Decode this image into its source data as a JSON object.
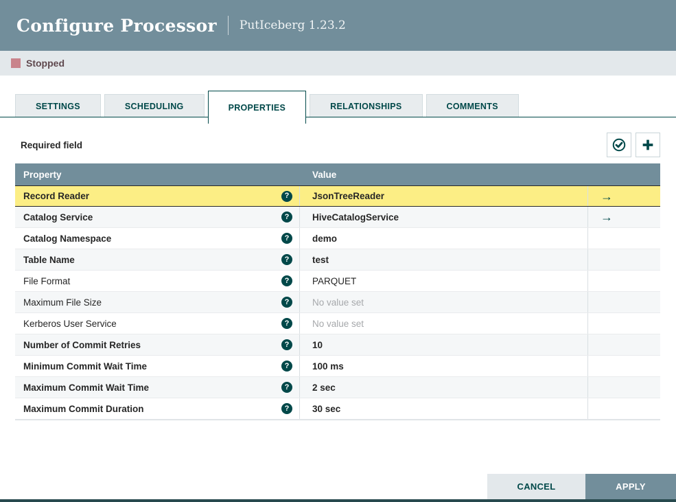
{
  "dialog": {
    "title": "Configure Processor",
    "subtitle": "PutIceberg 1.23.2",
    "status_label": "Stopped"
  },
  "tabs": [
    {
      "label": "SETTINGS",
      "active": false
    },
    {
      "label": "SCHEDULING",
      "active": false
    },
    {
      "label": "PROPERTIES",
      "active": true
    },
    {
      "label": "RELATIONSHIPS",
      "active": false
    },
    {
      "label": "COMMENTS",
      "active": false
    }
  ],
  "properties_panel": {
    "required_field_label": "Required field",
    "actions": [
      {
        "name": "verify-properties",
        "icon": "check-circle-icon"
      },
      {
        "name": "add-property",
        "icon": "plus-icon"
      }
    ],
    "table": {
      "columns": [
        "Property",
        "Value"
      ],
      "rows": [
        {
          "property": "Record Reader",
          "value": "JsonTreeReader",
          "required": true,
          "selected": true,
          "has_goto": true,
          "no_value": false
        },
        {
          "property": "Catalog Service",
          "value": "HiveCatalogService",
          "required": true,
          "selected": false,
          "has_goto": true,
          "no_value": false
        },
        {
          "property": "Catalog Namespace",
          "value": "demo",
          "required": true,
          "selected": false,
          "has_goto": false,
          "no_value": false
        },
        {
          "property": "Table Name",
          "value": "test",
          "required": true,
          "selected": false,
          "has_goto": false,
          "no_value": false
        },
        {
          "property": "File Format",
          "value": "PARQUET",
          "required": false,
          "selected": false,
          "has_goto": false,
          "no_value": false
        },
        {
          "property": "Maximum File Size",
          "value": "No value set",
          "required": false,
          "selected": false,
          "has_goto": false,
          "no_value": true
        },
        {
          "property": "Kerberos User Service",
          "value": "No value set",
          "required": false,
          "selected": false,
          "has_goto": false,
          "no_value": true
        },
        {
          "property": "Number of Commit Retries",
          "value": "10",
          "required": true,
          "selected": false,
          "has_goto": false,
          "no_value": false
        },
        {
          "property": "Minimum Commit Wait Time",
          "value": "100 ms",
          "required": true,
          "selected": false,
          "has_goto": false,
          "no_value": false
        },
        {
          "property": "Maximum Commit Wait Time",
          "value": "2 sec",
          "required": true,
          "selected": false,
          "has_goto": false,
          "no_value": false
        },
        {
          "property": "Maximum Commit Duration",
          "value": "30 sec",
          "required": true,
          "selected": false,
          "has_goto": false,
          "no_value": false
        }
      ]
    }
  },
  "footer": {
    "cancel_label": "CANCEL",
    "apply_label": "APPLY"
  },
  "colors": {
    "header_bg": "#728e9b",
    "accent_teal": "#004849",
    "selected_row_bg": "#fcee85",
    "stopped_red": "#c9848c",
    "status_bar_bg": "#e3e8eb",
    "row_stripe_bg": "#f5f7f8"
  }
}
